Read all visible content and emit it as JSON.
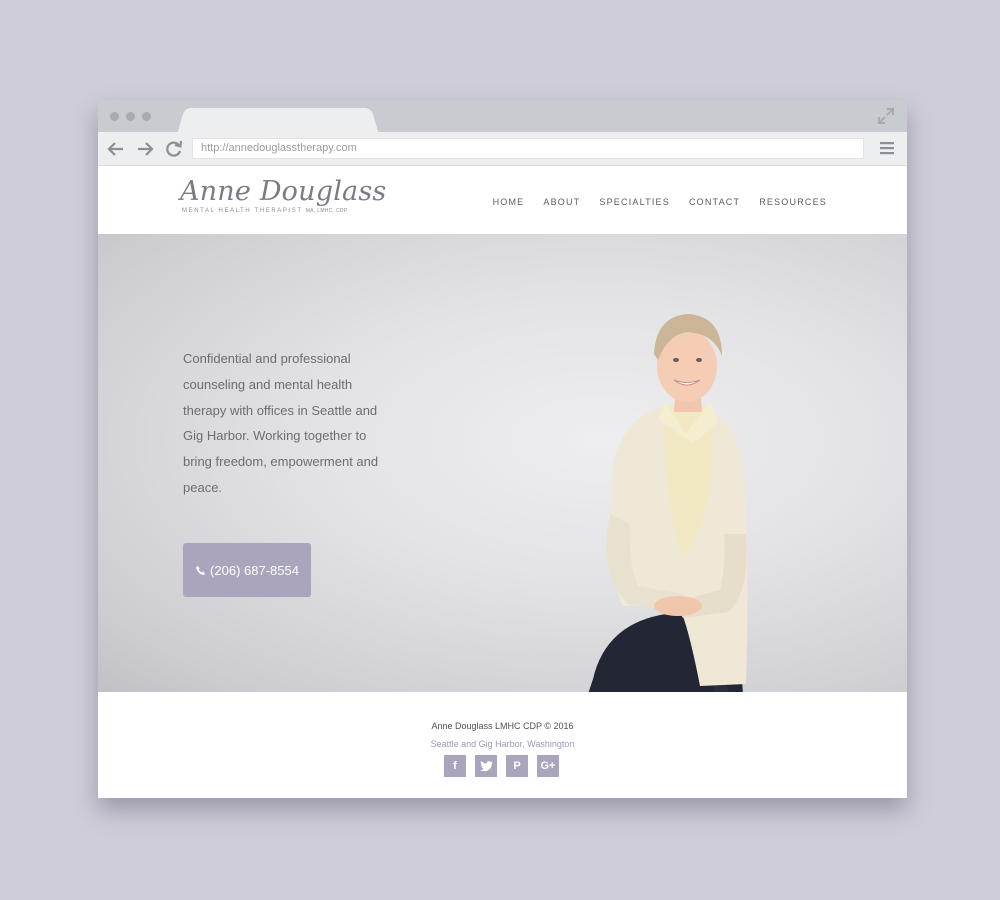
{
  "browser": {
    "url": "http://annedouglasstherapy.com"
  },
  "logo": {
    "name": "Anne Douglass",
    "subtitle": "MENTAL HEALTH THERAPIST",
    "credentials": "MA, LMHC, CDP"
  },
  "nav": {
    "items": [
      "HOME",
      "ABOUT",
      "SPECIALTIES",
      "CONTACT",
      "RESOURCES"
    ]
  },
  "hero": {
    "text": "Confidential and professional counseling and mental health therapy with offices in Seattle and Gig Harbor. Working together to bring freedom, empowerment and peace.",
    "phone": "(206) 687-8554"
  },
  "footer": {
    "copyright": "Anne Douglass LMHC CDP © 2016",
    "location": "Seattle and Gig Harbor, Washington",
    "socials": [
      "f",
      "t",
      "P",
      "G+"
    ]
  },
  "colors": {
    "accent": "#aaa5bc",
    "background": "#cfcdd9",
    "chrome": "#c8cbd0"
  }
}
